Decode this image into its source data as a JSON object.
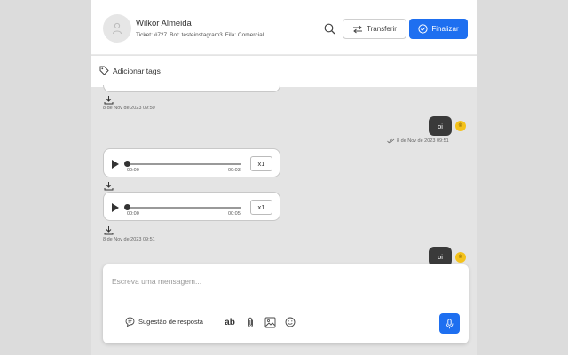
{
  "header": {
    "contact_name": "Wilkor Almeida",
    "ticket": "Ticket: #727",
    "bot": "Bot: testeinstagram3",
    "queue": "Fila: Comercial",
    "transfer_label": "Transferir",
    "finalize_label": "Finalizar"
  },
  "tags": {
    "label": "Adicionar tags"
  },
  "messages": {
    "ts1": "8 de Nov de 2023 09:50",
    "out1": {
      "text": "oi",
      "timestamp": "8 de Nov de 2023 09:51",
      "badge": "©"
    },
    "audio1": {
      "current": "00:00",
      "duration": "00:03",
      "speed": "x1"
    },
    "audio2": {
      "current": "00:00",
      "duration": "00:05",
      "speed": "x1"
    },
    "ts2": "8 de Nov de 2023 09:51",
    "out2": {
      "text": "oi",
      "badge": "©"
    }
  },
  "composer": {
    "placeholder": "Escreva uma mensagem...",
    "suggestion_label": "Sugestão de resposta",
    "format_label": "ab"
  },
  "colors": {
    "accent": "#1e6ff0",
    "badge": "#f4c21b",
    "outgoing": "#3a3a3a"
  }
}
